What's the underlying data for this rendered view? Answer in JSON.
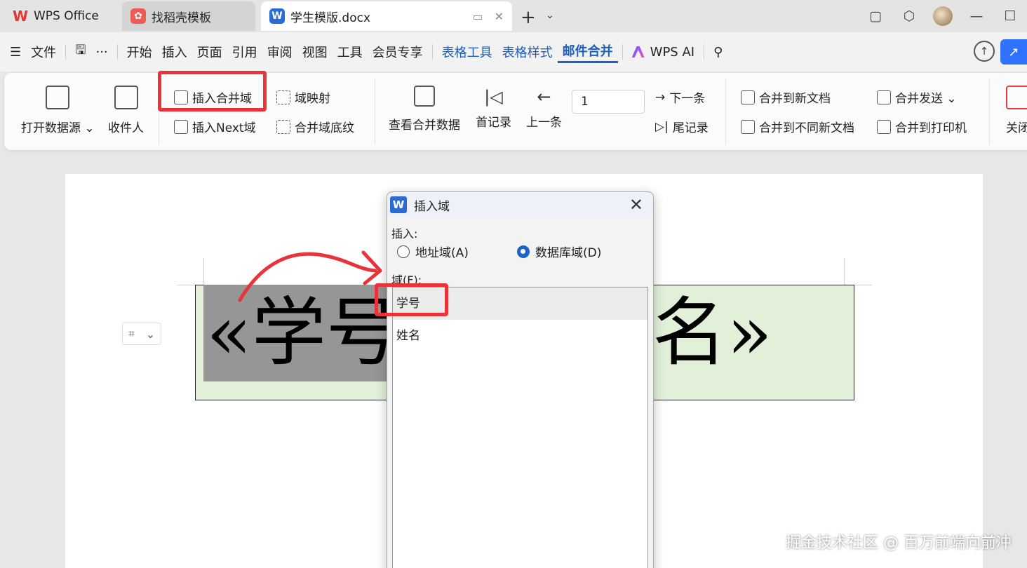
{
  "tabs": [
    {
      "label": "WPS Office",
      "icon": "wps-logo-icon"
    },
    {
      "label": "找稻壳模板",
      "icon": "docer-icon"
    },
    {
      "label": "学生模版.docx",
      "icon": "word-doc-icon",
      "active": true
    }
  ],
  "menu": {
    "file": "文件",
    "items": [
      "开始",
      "插入",
      "页面",
      "引用",
      "审阅",
      "视图",
      "工具",
      "会员专享"
    ],
    "context_items": [
      "表格工具",
      "表格样式"
    ],
    "active": "邮件合并",
    "ai": "WPS AI"
  },
  "ribbon": {
    "open_source": "打开数据源",
    "recipients": "收件人",
    "insert_merge_field": "插入合并域",
    "field_mapping": "域映射",
    "insert_next_field": "插入Next域",
    "merge_field_shading": "合并域底纹",
    "view_merged_data": "查看合并数据",
    "first_record": "首记录",
    "prev_record": "上一条",
    "record_value": "1",
    "next_record": "下一条",
    "last_record": "尾记录",
    "merge_new_doc": "合并到新文档",
    "merge_different_docs": "合并到不同新文档",
    "merge_send": "合并发送",
    "merge_printer": "合并到打印机",
    "close": "关闭"
  },
  "document": {
    "field_left": "«学号",
    "field_right": "名»"
  },
  "dialog": {
    "title": "插入域",
    "insert_label": "插入:",
    "radio_address": "地址域(A)",
    "radio_database": "数据库域(D)",
    "selected_radio": "database",
    "fields_label": "域(F):",
    "fields": [
      "学号",
      "姓名"
    ],
    "selected_field": "学号"
  },
  "watermark": "掘金技术社区 @ 百万前端向前冲",
  "colors": {
    "accent": "#1f5fbf",
    "highlight_red": "#e8333a",
    "cell_fill": "#e2f0d9",
    "field_shading": "#969696"
  }
}
